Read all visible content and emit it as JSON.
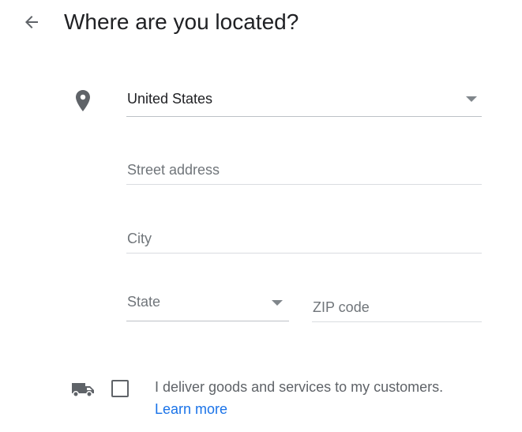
{
  "header": {
    "title": "Where are you located?",
    "back_icon": "arrow-back-icon"
  },
  "form": {
    "location_icon": "place-marker-icon",
    "country": {
      "value": "United States",
      "icon": "dropdown-arrow-icon"
    },
    "street": {
      "placeholder": "Street address"
    },
    "city": {
      "placeholder": "City"
    },
    "state": {
      "placeholder": "State",
      "icon": "dropdown-arrow-icon"
    },
    "zip": {
      "placeholder": "ZIP code"
    }
  },
  "delivery": {
    "icon": "truck-icon",
    "checked": false,
    "label": "I deliver goods and services to my customers.",
    "learn_more": "Learn more"
  },
  "colors": {
    "link": "#1a73e8",
    "text": "#202124",
    "muted": "#70757a",
    "icon": "#5f6368"
  }
}
